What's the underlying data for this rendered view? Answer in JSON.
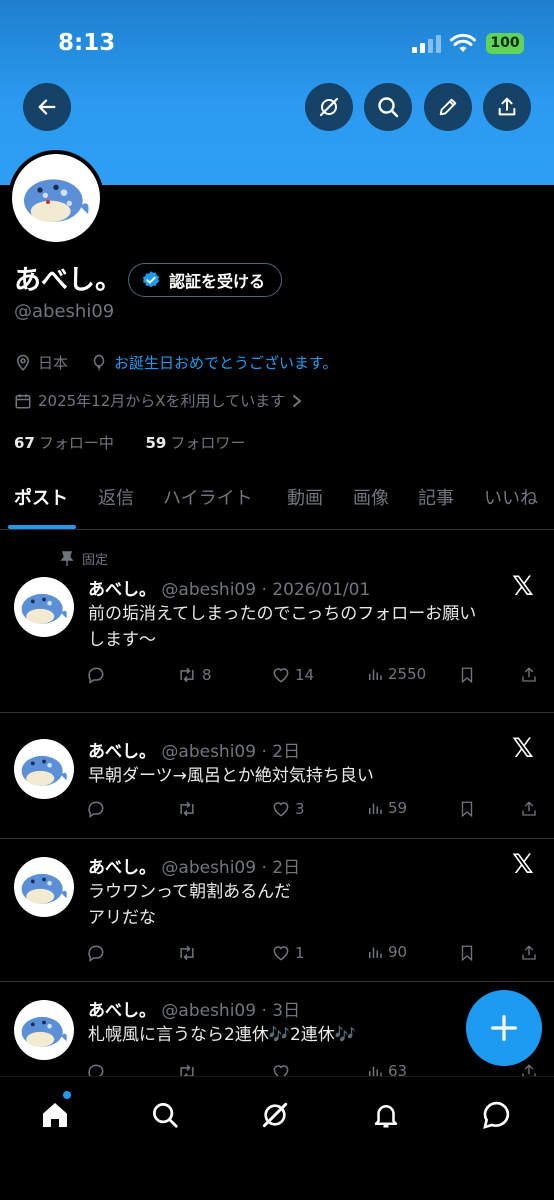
{
  "status_bar": {
    "time": "8:13",
    "battery": "100"
  },
  "profile": {
    "name": "あべし。",
    "verify_button": "認証を受ける",
    "handle": "@abeshi09",
    "location": "日本",
    "birthday_note": "お誕生日おめでとうございます。",
    "joined": "2025年12月からXを利用しています",
    "following_count": "67",
    "following_label": "フォロー中",
    "followers_count": "59",
    "followers_label": "フォロワー"
  },
  "tabs": [
    "ポスト",
    "返信",
    "ハイライト",
    "動画",
    "画像",
    "記事",
    "いいね"
  ],
  "pinned_label": "固定",
  "posts": [
    {
      "name": "あべし。",
      "meta": "@abeshi09 · 2026/01/01",
      "text_lines": [
        "前の垢消えてしまったのでこっちのフォローお願い",
        "します〜"
      ],
      "retweets": "8",
      "likes": "14",
      "views": "2550"
    },
    {
      "name": "あべし。",
      "meta": "@abeshi09 · 2日",
      "text_lines": [
        "早朝ダーツ→風呂とか絶対気持ち良い"
      ],
      "retweets": "",
      "likes": "3",
      "views": "59"
    },
    {
      "name": "あべし。",
      "meta": "@abeshi09 · 2日",
      "text_lines": [
        "ラウワンって朝割あるんだ",
        "アリだな"
      ],
      "retweets": "",
      "likes": "1",
      "views": "90"
    },
    {
      "name": "あべし。",
      "meta": "@abeshi09 · 3日",
      "text_lines": [
        "札幌風に言うなら2連休🎶2連休🎶"
      ],
      "retweets": "",
      "likes": "",
      "views": "63"
    }
  ],
  "colors": {
    "accent": "#1d9bf0",
    "banner": "#2b9af0",
    "background": "#000000",
    "muted": "#71767b"
  }
}
